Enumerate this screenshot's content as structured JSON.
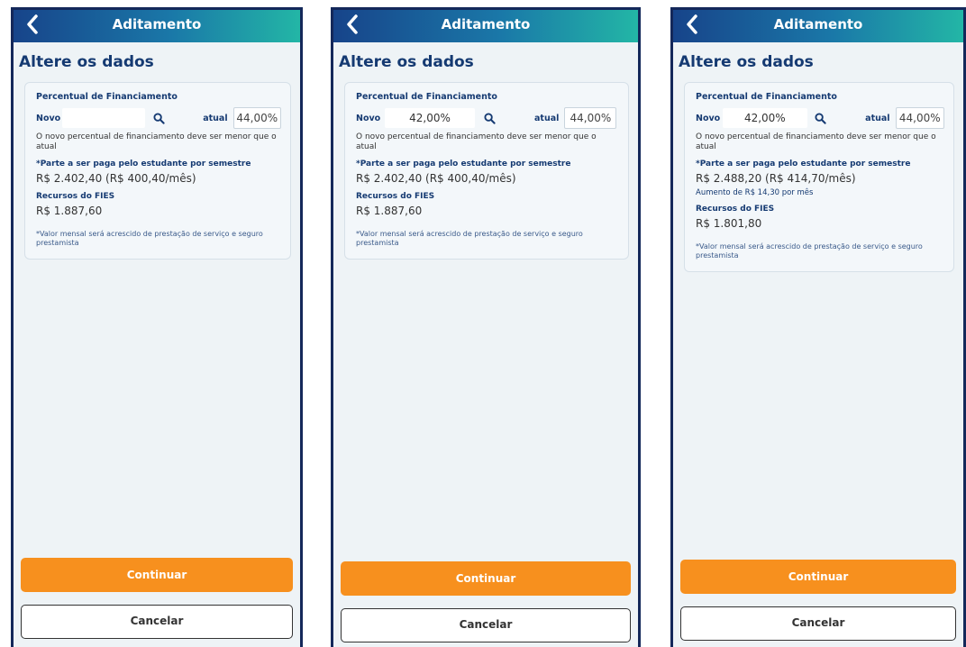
{
  "header_title": "Aditamento",
  "page_title": "Altere os dados",
  "labels": {
    "percentual": "Percentual de Financiamento",
    "novo": "Novo",
    "atual": "atual",
    "hint": "O novo percentual de financiamento deve ser menor que o atual",
    "parte": "*Parte a ser paga pelo estudante por semestre",
    "recursos": "Recursos do FIES",
    "note": "*Valor mensal será acrescido de prestação de serviço e seguro prestamista"
  },
  "buttons": {
    "continuar": "Continuar",
    "cancelar": "Cancelar"
  },
  "screens": [
    {
      "novo_value": "",
      "atual_value": "44,00%",
      "parte_value": "R$ 2.402,40 (R$ 400,40/mês)",
      "aumento": "",
      "recursos_value": "R$ 1.887,60"
    },
    {
      "novo_value": "42,00%",
      "atual_value": "44,00%",
      "parte_value": "R$ 2.402,40 (R$ 400,40/mês)",
      "aumento": "",
      "recursos_value": "R$ 1.887,60"
    },
    {
      "novo_value": "42,00%",
      "atual_value": "44,00%",
      "parte_value": "R$ 2.488,20 (R$ 414,70/mês)",
      "aumento": "Aumento de R$ 14,30 por mês",
      "recursos_value": "R$ 1.801,80"
    }
  ],
  "icons": {
    "back": "chevron-left-icon",
    "search": "search-icon"
  },
  "colors": {
    "accent": "#f7901e",
    "brand": "#153a72",
    "header_start": "#17448a",
    "header_end": "#23b6a6"
  }
}
